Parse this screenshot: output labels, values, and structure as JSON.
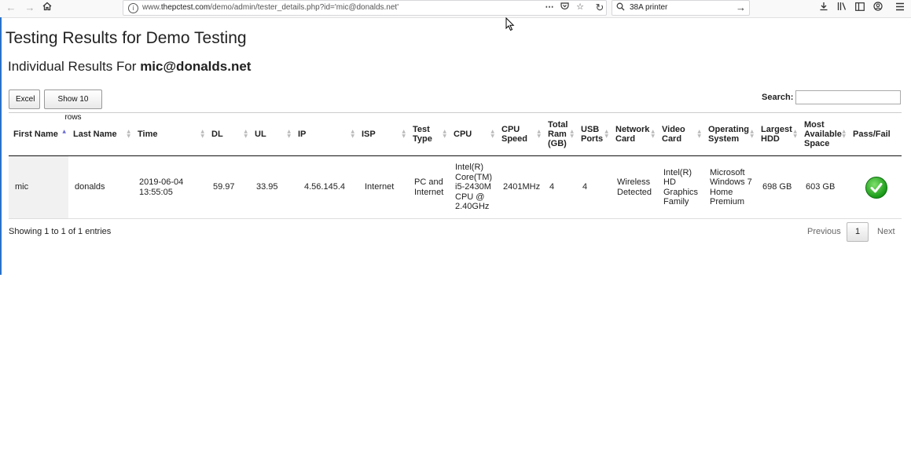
{
  "browser": {
    "url_prefix": "www.",
    "url_domain": "thepctest.com",
    "url_path": "/demo/admin/tester_details.php?id='mic@donalds.net'",
    "search_value": "38A printer"
  },
  "page": {
    "title": "Testing Results for Demo Testing",
    "subtitle_prefix": "Individual Results For ",
    "subtitle_email": "mic@donalds.net"
  },
  "controls": {
    "excel_label": "Excel",
    "rows_label": "Show 10 rows",
    "search_label": "Search:",
    "search_value": ""
  },
  "table": {
    "headers": [
      "First Name",
      "Last Name",
      "Time",
      "DL",
      "UL",
      "IP",
      "ISP",
      "Test Type",
      "CPU",
      "CPU Speed",
      "Total Ram (GB)",
      "USB Ports",
      "Network Card",
      "Video Card",
      "Operating System",
      "Largest HDD",
      "Most Available Space",
      "Pass/Fail"
    ],
    "sorted_column": "First Name",
    "sort_direction": "ascending",
    "rows": [
      {
        "first_name": "mic",
        "last_name": "donalds",
        "time": "2019-06-04 13:55:05",
        "dl": "59.97",
        "ul": "33.95",
        "ip": "4.56.145.4",
        "isp": "Internet",
        "test_type": "PC and Internet",
        "cpu": "Intel(R) Core(TM) i5-2430M CPU @ 2.40GHz",
        "cpu_speed": "2401MHz",
        "total_ram": "4",
        "usb_ports": "4",
        "network_card": "Wireless Detected",
        "video_card": "Intel(R) HD Graphics Family",
        "os": "Microsoft Windows 7 Home Premium",
        "largest_hdd": "698 GB",
        "available_space": "603 GB",
        "pass_fail": "pass"
      }
    ]
  },
  "footer": {
    "info": "Showing 1 to 1 of 1 entries",
    "previous": "Previous",
    "page": "1",
    "next": "Next"
  },
  "colors": {
    "pass": "#1a9a19",
    "sort_active": "#6b6bd6"
  }
}
